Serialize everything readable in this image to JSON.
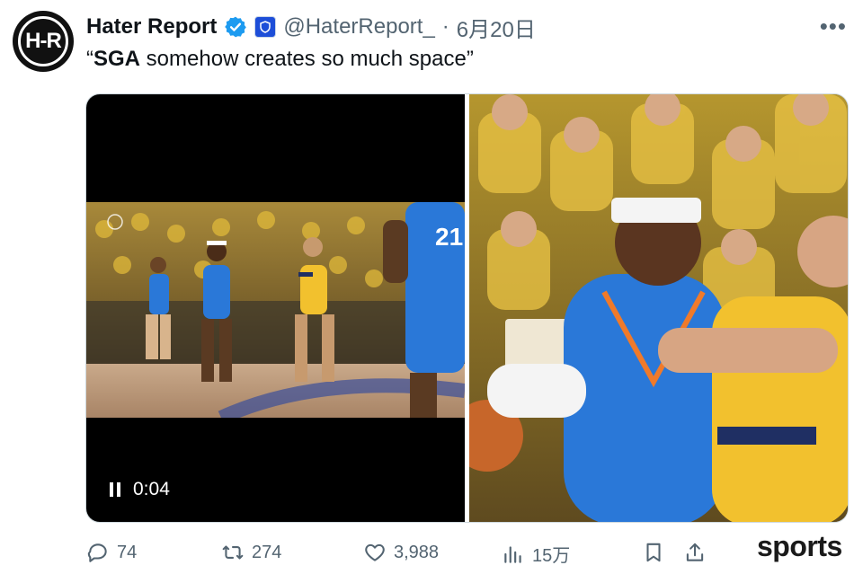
{
  "author": {
    "avatar_text": "H-R",
    "display_name": "Hater Report",
    "handle": "@HaterReport_",
    "separator": "·",
    "date": "6月20日"
  },
  "tweet": {
    "text_bold": "SGA",
    "text_rest": " somehow creates so much space",
    "open_quote": "“",
    "close_quote": "”"
  },
  "video": {
    "timestamp": "0:04",
    "jersey_number": "21"
  },
  "actions": {
    "replies": "74",
    "reposts": "274",
    "likes": "3,988",
    "views": "15万"
  },
  "watermark": "sports",
  "colors": {
    "verified_blue": "#1d9bf0",
    "thunder_blue": "#2a78d8",
    "pacers_gold": "#f2c12e",
    "text_secondary": "#536471"
  },
  "icons": {
    "more": "more-horizontal-icon",
    "reply": "reply-icon",
    "repost": "repost-icon",
    "like": "heart-icon",
    "views": "analytics-icon",
    "bookmark": "bookmark-icon",
    "share": "share-icon"
  }
}
